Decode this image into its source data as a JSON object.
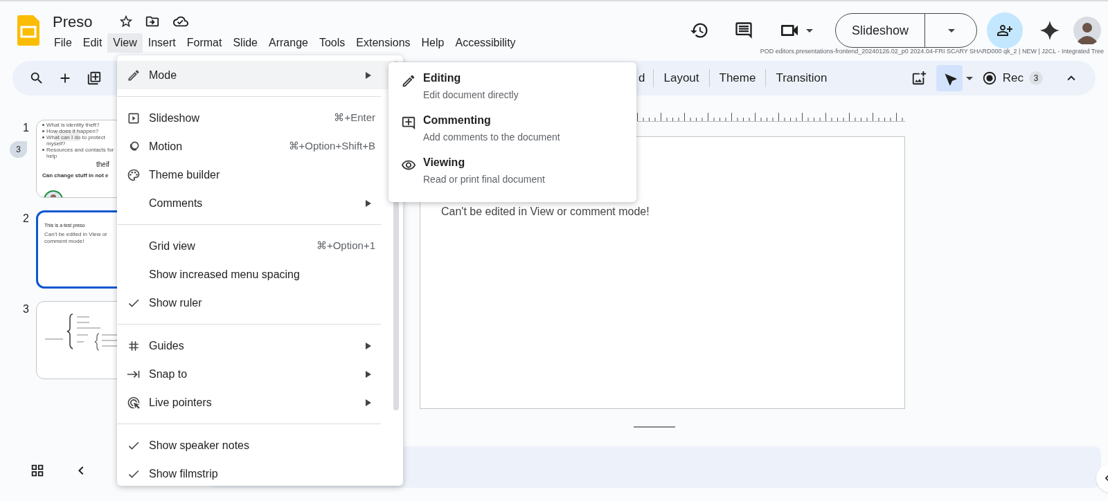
{
  "document": {
    "title": "Preso"
  },
  "menubar": [
    {
      "label": "File",
      "selected": false
    },
    {
      "label": "Edit",
      "selected": false
    },
    {
      "label": "View",
      "selected": true
    },
    {
      "label": "Insert",
      "selected": false
    },
    {
      "label": "Format",
      "selected": false
    },
    {
      "label": "Slide",
      "selected": false
    },
    {
      "label": "Arrange",
      "selected": false
    },
    {
      "label": "Tools",
      "selected": false
    },
    {
      "label": "Extensions",
      "selected": false
    },
    {
      "label": "Help",
      "selected": false
    },
    {
      "label": "Accessibility",
      "selected": false
    }
  ],
  "slideshow_button": "Slideshow",
  "build_info": "POD editors.presentations-frontend_20240126.02_p0 2024.04-FRI SCARY SHARD000 qk_2 | NEW | J2CL - Integrated Tree",
  "toolbar": {
    "partial_label": "d",
    "buttons": [
      "Layout",
      "Theme",
      "Transition"
    ],
    "pointer_tool": {
      "selected": true
    },
    "record": {
      "label": "Rec",
      "count": "3"
    }
  },
  "filmstrip": [
    {
      "number": "1",
      "selected": false,
      "kind": "title",
      "comment_count": "3",
      "bullets": [
        "What is identity theft?",
        "How does it happen?",
        "What can I do to protect myself?",
        "Resources and contacts for help"
      ],
      "title": "theif",
      "subtitle": "Can change stuff in not e"
    },
    {
      "number": "2",
      "selected": true,
      "kind": "text",
      "title": "This is a test preso",
      "body": "Can't be edited in View or comment mode!"
    },
    {
      "number": "3",
      "selected": false,
      "kind": "formula"
    }
  ],
  "slide": {
    "body": "Can't be edited in View or comment mode!"
  },
  "view_menu": {
    "sections": [
      [
        {
          "label": "Mode",
          "submenu": true,
          "highlighted": true
        }
      ],
      [
        {
          "label": "Slideshow",
          "shortcut": "⌘+Enter",
          "submenu": false,
          "highlighted": false
        },
        {
          "label": "Motion",
          "shortcut": "⌘+Option+Shift+B",
          "submenu": false,
          "highlighted": false
        },
        {
          "label": "Theme builder",
          "submenu": false,
          "highlighted": false
        },
        {
          "label": "Comments",
          "submenu": true,
          "highlighted": false
        }
      ],
      [
        {
          "label": "Grid view",
          "checked": false,
          "shortcut": "⌘+Option+1",
          "submenu": false,
          "highlighted": false
        },
        {
          "label": "Show increased menu spacing",
          "checked": false,
          "submenu": false,
          "highlighted": false
        },
        {
          "label": "Show ruler",
          "checked": true,
          "submenu": false,
          "highlighted": false
        }
      ],
      [
        {
          "label": "Guides",
          "submenu": true,
          "highlighted": false
        },
        {
          "label": "Snap to",
          "submenu": true,
          "highlighted": false
        },
        {
          "label": "Live pointers",
          "submenu": true,
          "highlighted": false
        }
      ],
      [
        {
          "label": "Show speaker notes",
          "checked": true,
          "submenu": false,
          "highlighted": false
        },
        {
          "label": "Show filmstrip",
          "checked": true,
          "submenu": false,
          "highlighted": false
        }
      ]
    ]
  },
  "mode_submenu": [
    {
      "label": "Editing",
      "description": "Edit document directly"
    },
    {
      "label": "Commenting",
      "description": "Add comments to the document"
    },
    {
      "label": "Viewing",
      "description": "Read or print final document"
    }
  ]
}
